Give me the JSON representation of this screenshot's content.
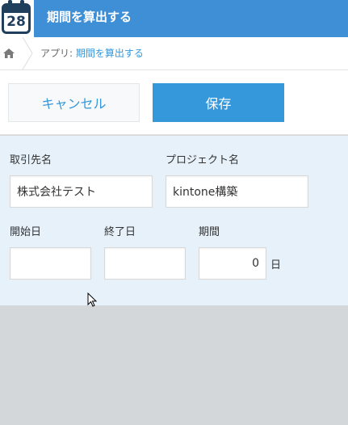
{
  "header": {
    "icon_name": "calendar-icon",
    "icon_number": "28",
    "title": "期間を算出する"
  },
  "breadcrumb": {
    "home_icon": "home-icon",
    "prefix": "アプリ: ",
    "app_name": "期間を算出する"
  },
  "toolbar": {
    "cancel_label": "キャンセル",
    "save_label": "保存"
  },
  "form": {
    "client_label": "取引先名",
    "client_value": "株式会社テスト",
    "project_label": "プロジェクト名",
    "project_value": "kintone構築",
    "start_label": "開始日",
    "start_value": "",
    "end_label": "終了日",
    "end_value": "",
    "period_label": "期間",
    "period_value": "0",
    "period_unit": "日"
  },
  "colors": {
    "header": "#3e8fd6",
    "accent": "#3498db",
    "form_bg": "#e7f1fa",
    "page_bg": "#d3d7d9"
  }
}
